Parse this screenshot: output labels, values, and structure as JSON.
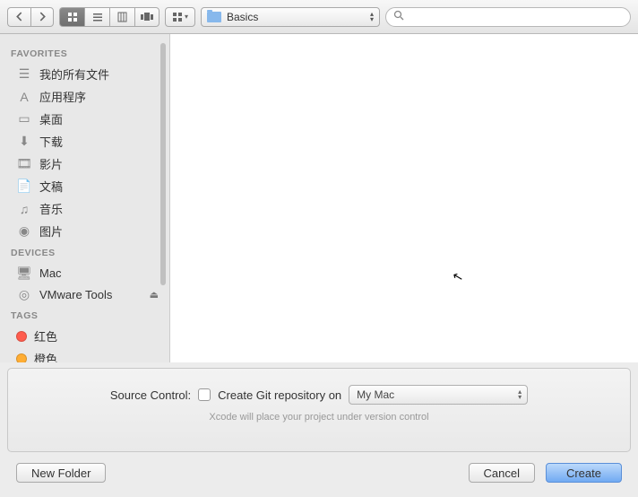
{
  "toolbar": {
    "path_label": "Basics",
    "search_placeholder": ""
  },
  "sidebar": {
    "favorites": {
      "header": "FAVORITES",
      "items": [
        {
          "label": "我的所有文件",
          "icon": "all-files-icon"
        },
        {
          "label": "应用程序",
          "icon": "applications-icon"
        },
        {
          "label": "桌面",
          "icon": "desktop-icon"
        },
        {
          "label": "下载",
          "icon": "downloads-icon"
        },
        {
          "label": "影片",
          "icon": "movies-icon"
        },
        {
          "label": "文稿",
          "icon": "documents-icon"
        },
        {
          "label": "音乐",
          "icon": "music-icon"
        },
        {
          "label": "图片",
          "icon": "pictures-icon"
        }
      ]
    },
    "devices": {
      "header": "DEVICES",
      "items": [
        {
          "label": "Mac",
          "icon": "computer-icon"
        },
        {
          "label": "VMware Tools",
          "icon": "disc-icon",
          "eject": true
        }
      ]
    },
    "tags": {
      "header": "TAGS",
      "items": [
        {
          "label": "红色",
          "color": "#ff5c4d"
        },
        {
          "label": "橙色",
          "color": "#ffad33"
        }
      ]
    }
  },
  "options": {
    "label": "Source Control:",
    "checkbox_label": "Create Git repository on",
    "location": "My Mac",
    "hint": "Xcode will place your project under version control"
  },
  "buttons": {
    "new_folder": "New Folder",
    "cancel": "Cancel",
    "create": "Create"
  }
}
